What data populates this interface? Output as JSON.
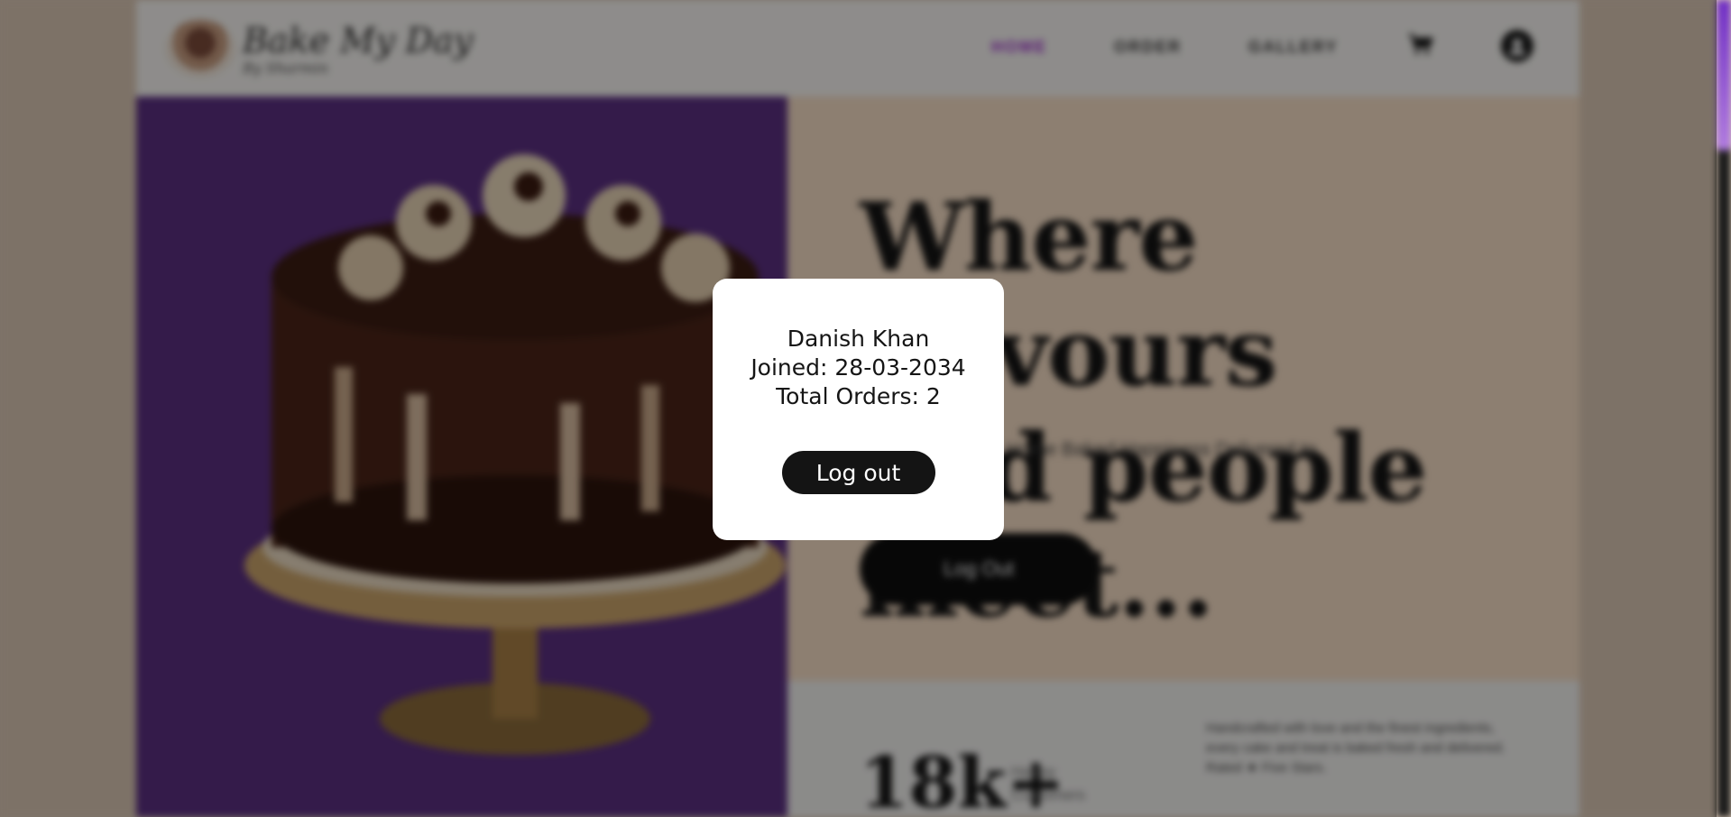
{
  "brand": {
    "name": "Bake My Day",
    "tagline": "By Sharmin"
  },
  "nav": {
    "items": [
      {
        "label": "HOME"
      },
      {
        "label": "ORDER"
      },
      {
        "label": "GALLERY"
      }
    ]
  },
  "hero": {
    "title_line1": "Where flavours",
    "title_line2": "and people meet...",
    "subtitle": "Sweet Moments, Home Baked Happiness Delivered to",
    "button_label": "Log Out"
  },
  "stats": {
    "number": "18k+",
    "label_line1": "Happy",
    "label_line2": "Customers",
    "description": "Handcrafted with love and the finest ingredients, every cake and treat is baked fresh and delivered. Rated ★ Five Stars."
  },
  "profile_modal": {
    "name": "Danish Khan",
    "joined": "Joined: 28-03-2034",
    "total_orders": "Total Orders: 2",
    "logout_label": "Log out"
  },
  "colors": {
    "accent": "#9c2fc9",
    "hero_panel": "#5a2f80",
    "cream": "#f3dbc3"
  }
}
